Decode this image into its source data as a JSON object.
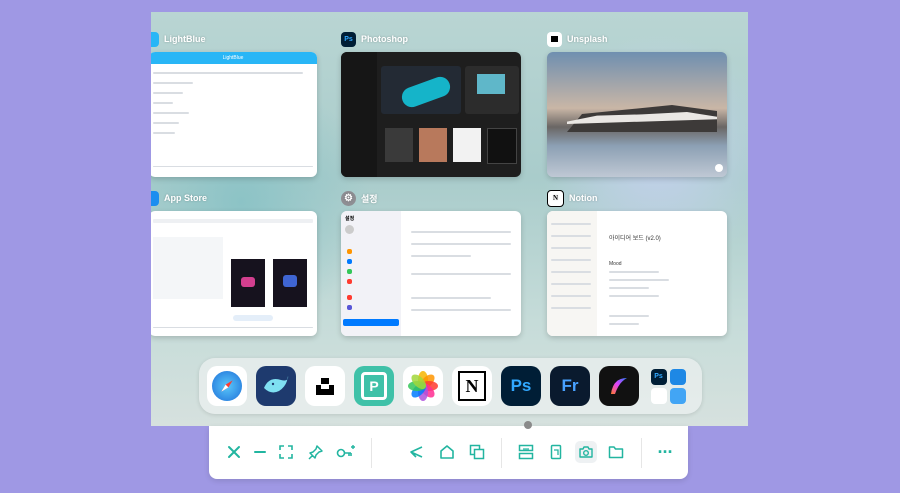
{
  "apps": [
    {
      "name": "LightBlue",
      "icon": "lightblue-app-icon",
      "card_title": "LightBlue"
    },
    {
      "name": "Photoshop",
      "icon": "photoshop-app-icon",
      "icon_text": "Ps"
    },
    {
      "name": "Unsplash",
      "icon": "unsplash-app-icon"
    },
    {
      "name": "App Store",
      "icon": "app-store-icon"
    },
    {
      "name": "설정",
      "icon": "settings-gear-icon",
      "sidebar_title": "설정"
    },
    {
      "name": "Notion",
      "icon": "notion-app-icon",
      "page_title": "아이디어 보드 (v2.0)",
      "heading": "Mood"
    }
  ],
  "dock": [
    {
      "name": "safari",
      "icon": "safari-icon"
    },
    {
      "name": "lightblue",
      "icon": "lightblue-whale-icon"
    },
    {
      "name": "unsplash",
      "icon": "unsplash-icon"
    },
    {
      "name": "picsart",
      "icon": "picsart-icon",
      "text": "P"
    },
    {
      "name": "photos",
      "icon": "photos-icon"
    },
    {
      "name": "notion",
      "icon": "notion-icon",
      "text": "N"
    },
    {
      "name": "photoshop",
      "icon": "photoshop-icon",
      "text": "Ps"
    },
    {
      "name": "fresco",
      "icon": "fresco-icon",
      "text": "Fr"
    },
    {
      "name": "procreate",
      "icon": "procreate-icon"
    },
    {
      "name": "app-library",
      "icon": "app-library-icon"
    }
  ],
  "toolbar": [
    {
      "name": "close",
      "icon": "close-icon"
    },
    {
      "name": "minimize",
      "icon": "minus-icon"
    },
    {
      "name": "fullscreen",
      "icon": "fullscreen-icon"
    },
    {
      "name": "pin",
      "icon": "pin-icon"
    },
    {
      "name": "key",
      "icon": "key-icon"
    },
    {
      "name": "back",
      "icon": "back-arrow-icon"
    },
    {
      "name": "home",
      "icon": "home-icon"
    },
    {
      "name": "overview",
      "icon": "overview-icon"
    },
    {
      "name": "split-screen",
      "icon": "split-screen-icon"
    },
    {
      "name": "rotate",
      "icon": "rotate-screen-icon"
    },
    {
      "name": "screenshot",
      "icon": "camera-icon"
    },
    {
      "name": "files",
      "icon": "folder-icon"
    },
    {
      "name": "more",
      "icon": "more-icon",
      "text": "···"
    }
  ],
  "colors": {
    "accent": "#22b5a0",
    "background": "#9f98e4",
    "lightblue": "#29b6f6",
    "photoshop": "#001e36",
    "ps_text": "#31a8ff"
  }
}
